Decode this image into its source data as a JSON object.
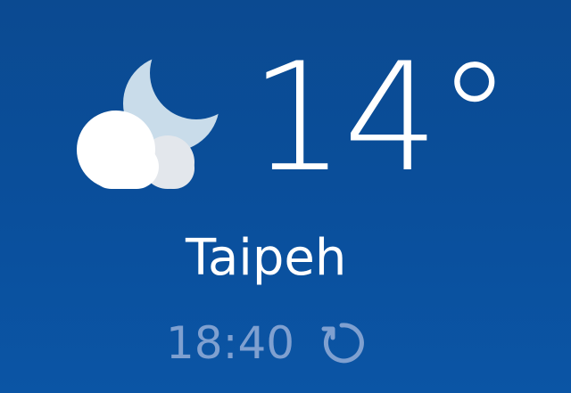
{
  "weather": {
    "temperature": "14°",
    "condition_icon": "partly-cloudy-night-icon",
    "location": "Taipeh",
    "last_updated": "18:40",
    "refresh_icon": "refresh-icon"
  },
  "colors": {
    "background_top": "#0b4a91",
    "background_bottom": "#0b55a5",
    "primary_text": "#ffffff",
    "secondary_text": "#7fa0d0",
    "moon": "#c9dcea",
    "cloud": "#ffffff",
    "cloud_shadow": "#e3e7ec"
  }
}
